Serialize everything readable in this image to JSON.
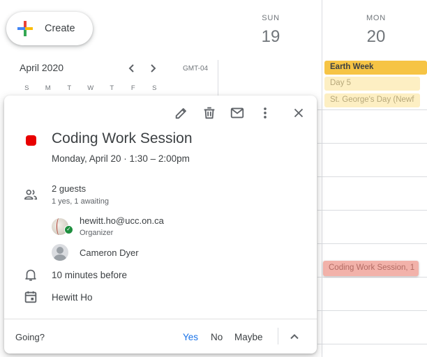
{
  "create": {
    "label": "Create",
    "icon": "plus-multicolor-icon"
  },
  "mini_calendar": {
    "month_label": "April 2020",
    "timezone": "GMT-04",
    "weekdays": [
      "S",
      "M",
      "T",
      "W",
      "T",
      "F",
      "S"
    ]
  },
  "week_header": {
    "days": [
      {
        "name": "SUN",
        "number": "19"
      },
      {
        "name": "MON",
        "number": "20"
      }
    ]
  },
  "all_day_events": [
    "Earth Week",
    "Day 5",
    "St. George's Day (Newf"
  ],
  "timed_event_chip": "Coding Work Session, 1",
  "popup": {
    "toolbar_icons": [
      "edit-icon",
      "delete-icon",
      "email-icon",
      "more-options-icon",
      "close-icon"
    ],
    "event_color": "#e80000",
    "title": "Coding Work Session",
    "when": "Monday, April 20  ·  1:30 – 2:00pm",
    "guests_count": "2 guests",
    "guests_summary": "1 yes, 1 awaiting",
    "guests": [
      {
        "name": "hewitt.ho@ucc.on.ca",
        "role": "Organizer"
      },
      {
        "name": "Cameron Dyer",
        "role": ""
      }
    ],
    "reminder": "10 minutes before",
    "calendar_owner": "Hewitt Ho",
    "rsvp": {
      "prompt": "Going?",
      "yes": "Yes",
      "no": "No",
      "maybe": "Maybe"
    }
  },
  "colors": {
    "accent": "#1a73e8",
    "event_red": "#e80000",
    "allday_yellow": "#f6c445",
    "allday_pale": "#fdefc3",
    "chip_pink": "#f2b2aa"
  }
}
